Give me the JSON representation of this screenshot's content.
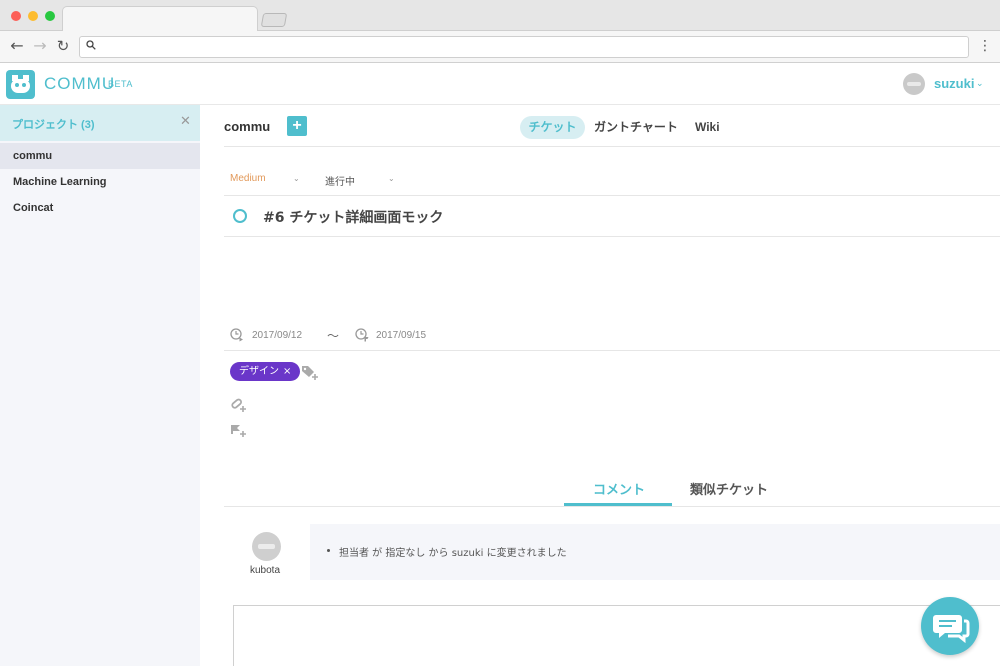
{
  "app": {
    "brand": "COMMU",
    "badge": "BETA",
    "accent": "#4fbecd"
  },
  "user": {
    "name": "suzuki"
  },
  "sidebar": {
    "header": "プロジェクト (3)",
    "items": [
      {
        "label": "commu",
        "active": true
      },
      {
        "label": "Machine Learning",
        "active": false
      },
      {
        "label": "Coincat",
        "active": false
      }
    ]
  },
  "main": {
    "project": "commu",
    "add_label": "+",
    "tabs": [
      {
        "label": "チケット",
        "active": true
      },
      {
        "label": "ガントチャート",
        "active": false
      },
      {
        "label": "Wiki",
        "active": false
      }
    ],
    "priority": "Medium",
    "status": "進行中"
  },
  "ticket": {
    "title": "#6 チケット詳細画面モック",
    "start_date": "2017/09/12",
    "date_sep": "〜",
    "end_date": "2017/09/15",
    "tag": "デザイン",
    "tag_remove": "×"
  },
  "comments": {
    "tabs": [
      {
        "label": "コメント",
        "active": true
      },
      {
        "label": "類似チケット",
        "active": false
      }
    ],
    "activity": [
      {
        "author": "kubota",
        "text": "担当者 が 指定なし から suzuki に変更されました"
      }
    ]
  }
}
